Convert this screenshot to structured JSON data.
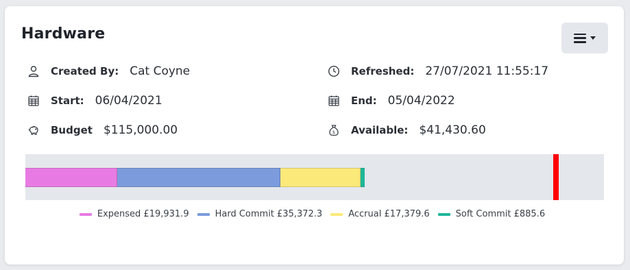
{
  "card": {
    "title": "Hardware",
    "menu_icon": "hamburger-dropdown-icon"
  },
  "details": {
    "created_by": {
      "icon": "user-icon",
      "label": "Created By:",
      "value": "Cat Coyne"
    },
    "refreshed": {
      "icon": "clock-icon",
      "label": "Refreshed:",
      "value": "27/07/2021 11:55:17"
    },
    "start": {
      "icon": "calendar-icon",
      "label": "Start:",
      "value": "06/04/2021"
    },
    "end": {
      "icon": "calendar-icon",
      "label": "End:",
      "value": "05/04/2022"
    },
    "budget": {
      "icon": "piggy-bank-icon",
      "label": "Budget",
      "value": "$115,000.00"
    },
    "available": {
      "icon": "money-bag-icon",
      "label": "Available:",
      "value": "$41,430.60"
    }
  },
  "colors": {
    "expensed": "#e87be3",
    "hard_commit": "#7b9bdc",
    "accrual": "#fbe97a",
    "soft_commit": "#1fb79a",
    "limit": "#ff0000",
    "track": "#e4e7ec"
  },
  "chart_data": {
    "type": "bar",
    "orientation": "horizontal-stacked",
    "total_budget": 115000,
    "limit_marker": 115000,
    "series": [
      {
        "name": "Expensed",
        "value": 19931.9,
        "color": "#e87be3"
      },
      {
        "name": "Hard Commit",
        "value": 35372.3,
        "color": "#7b9bdc"
      },
      {
        "name": "Accrual",
        "value": 17379.6,
        "color": "#fbe97a"
      },
      {
        "name": "Soft Commit",
        "value": 885.6,
        "color": "#1fb79a"
      }
    ],
    "legend": {
      "placement": "bottom-center",
      "entries": [
        "Expensed £19,931.9",
        "Hard Commit £35,372.3",
        "Accrual £17,379.6",
        "Soft Commit £885.6"
      ]
    }
  }
}
